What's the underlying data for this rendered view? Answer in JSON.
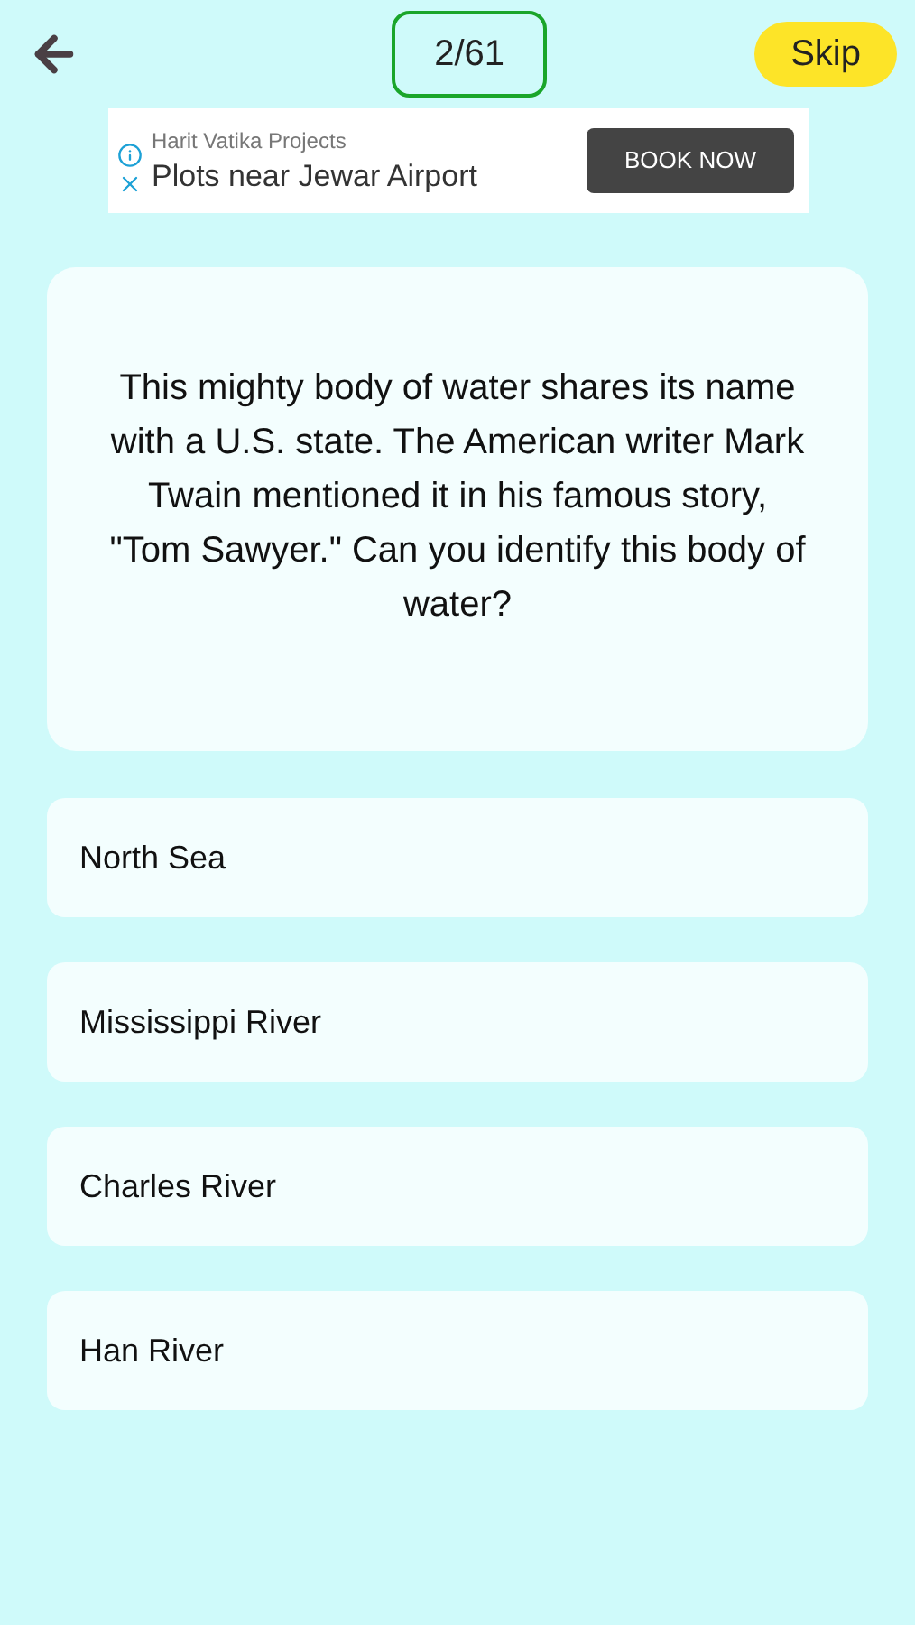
{
  "header": {
    "progress": "2/61",
    "skip": "Skip"
  },
  "ad": {
    "advertiser": "Harit Vatika Projects",
    "headline": "Plots near Jewar Airport",
    "cta": "BOOK NOW"
  },
  "question": "This mighty body of water shares its name with a U.S. state. The American writer Mark Twain mentioned it in his famous story, \"Tom Sawyer.\" Can you identify this body of water?",
  "options": [
    {
      "label": "North Sea"
    },
    {
      "label": "Mississippi River"
    },
    {
      "label": "Charles River"
    },
    {
      "label": "Han River"
    }
  ]
}
